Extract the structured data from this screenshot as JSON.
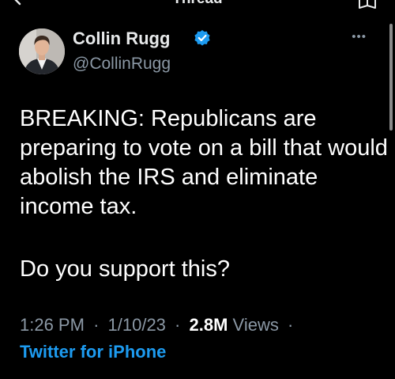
{
  "topbar": {
    "title": "Thread"
  },
  "author": {
    "name": "Collin Rugg",
    "handle": "@CollinRugg",
    "verified": true
  },
  "tweet": {
    "text": "BREAKING: Republicans are preparing to vote on a bill that would abolish the IRS and eliminate income tax.",
    "question": "Do you support this?"
  },
  "meta": {
    "time": "1:26 PM",
    "date": "1/10/23",
    "views_count": "2.8M",
    "views_label": "Views",
    "separator": "·",
    "source": "Twitter for iPhone"
  },
  "icons": {
    "back": "arrow-left-icon",
    "more": "more-horizontal-icon",
    "verified": "verified-badge-icon",
    "reader": "reader-icon"
  },
  "colors": {
    "background": "#000000",
    "text": "#ffffff",
    "secondary": "#8b98a5",
    "accent": "#1d9bf0"
  }
}
